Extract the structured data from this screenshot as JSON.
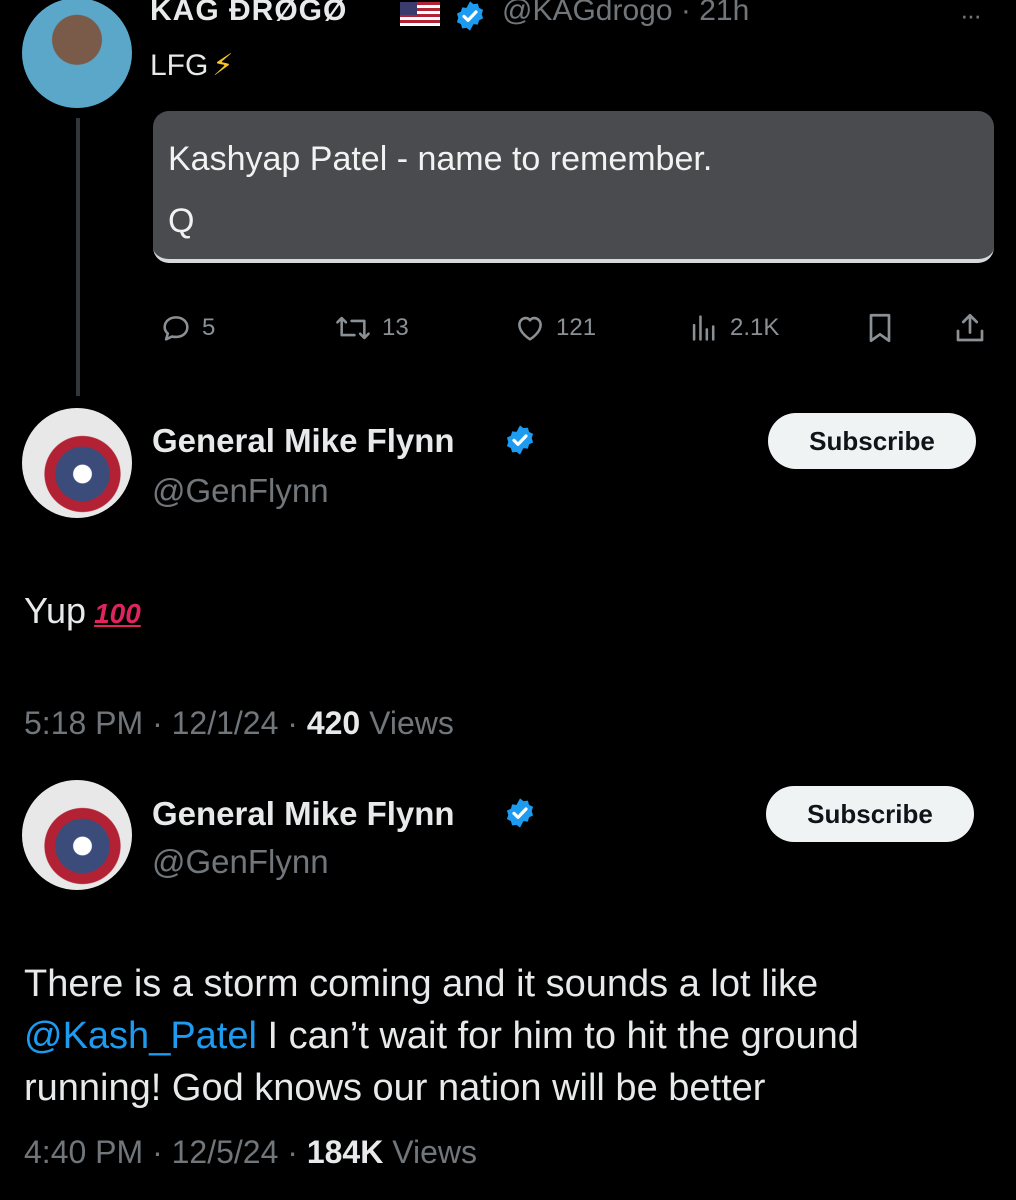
{
  "top_tweet": {
    "name": "KAG ĐRØGØ",
    "handle": "@KAGdrogo",
    "time": "· 21h",
    "more": "···",
    "text": "LFG",
    "bolt": "⚡",
    "quote_line1": "Kashyap Patel - name to remember.",
    "quote_line2": "Q",
    "stats": {
      "replies": "5",
      "reposts": "13",
      "likes": "121",
      "views": "2.1K"
    }
  },
  "reply_tweet": {
    "name": "General Mike Flynn",
    "handle": "@GenFlynn",
    "subscribe_label": "Subscribe",
    "text": "Yup",
    "emoji": "100",
    "time": "5:18 PM · 12/1/24 · ",
    "views_count": "420",
    "views_label": " Views"
  },
  "original_tweet": {
    "name": "General Mike Flynn",
    "handle": "@GenFlynn",
    "subscribe_label": "Subscribe",
    "text_part1": "There is a storm coming and it sounds a lot like ",
    "mention": "@Kash_Patel",
    "text_part2": " I can’t wait for him to hit the ground running! God knows our nation will be better",
    "time": "4:40 PM · 12/5/24 · ",
    "views_count": "184K",
    "views_label": " Views"
  },
  "colors": {
    "background": "#000000",
    "verified": "#1d9bf0",
    "mention": "#1d9bf0",
    "muted": "#71767b"
  }
}
